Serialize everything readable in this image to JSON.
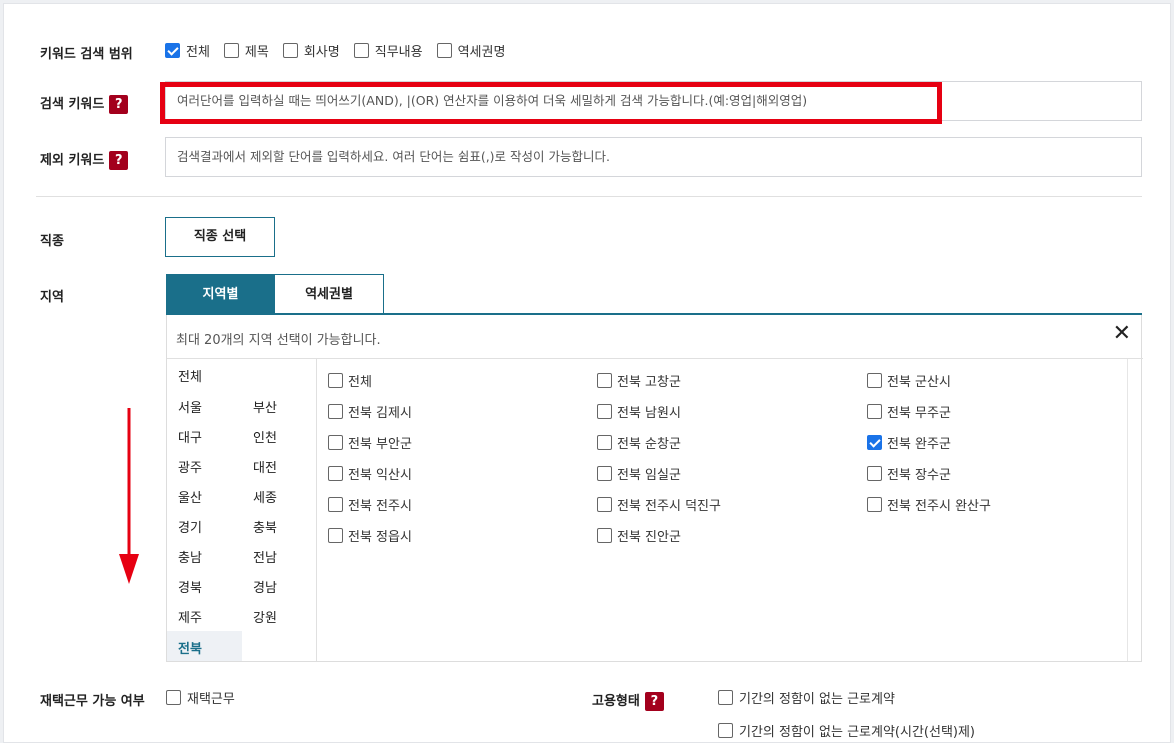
{
  "keyword_scope": {
    "label": "키워드 검색 범위",
    "options": [
      {
        "label": "전체",
        "checked": true
      },
      {
        "label": "제목",
        "checked": false
      },
      {
        "label": "회사명",
        "checked": false
      },
      {
        "label": "직무내용",
        "checked": false
      },
      {
        "label": "역세권명",
        "checked": false
      }
    ]
  },
  "search_keyword": {
    "label": "검색 키워드",
    "help": "?",
    "placeholder": "여러단어를 입력하실 때는 띄어쓰기(AND), |(OR) 연산자를 이용하여 더욱 세밀하게 검색 가능합니다.(예:영업|해외영업)"
  },
  "exclude_keyword": {
    "label": "제외 키워드",
    "help": "?",
    "placeholder": "검색결과에서 제외할 단어를 입력하세요. 여러 단어는 쉼표(,)로 작성이 가능합니다."
  },
  "job_type": {
    "label": "직종",
    "button": "직종 선택"
  },
  "region": {
    "label": "지역",
    "tabs": [
      "지역별",
      "역세권별"
    ],
    "info": "최대 20개의 지역 선택이 가능합니다.",
    "close": "✕",
    "provinces": [
      "전체",
      "서울",
      "부산",
      "대구",
      "인천",
      "광주",
      "대전",
      "울산",
      "세종",
      "경기",
      "충북",
      "충남",
      "전남",
      "경북",
      "경남",
      "제주",
      "강원",
      "전북"
    ],
    "selected_province": "전북",
    "cities": [
      {
        "label": "전체",
        "checked": false
      },
      {
        "label": "전북 고창군",
        "checked": false
      },
      {
        "label": "전북 군산시",
        "checked": false
      },
      {
        "label": "전북 김제시",
        "checked": false
      },
      {
        "label": "전북 남원시",
        "checked": false
      },
      {
        "label": "전북 무주군",
        "checked": false
      },
      {
        "label": "전북 부안군",
        "checked": false
      },
      {
        "label": "전북 순창군",
        "checked": false
      },
      {
        "label": "전북 완주군",
        "checked": true
      },
      {
        "label": "전북 익산시",
        "checked": false
      },
      {
        "label": "전북 임실군",
        "checked": false
      },
      {
        "label": "전북 장수군",
        "checked": false
      },
      {
        "label": "전북 전주시",
        "checked": false
      },
      {
        "label": "전북 전주시 덕진구",
        "checked": false
      },
      {
        "label": "전북 전주시 완산구",
        "checked": false
      },
      {
        "label": "전북 정읍시",
        "checked": false
      },
      {
        "label": "전북 진안군",
        "checked": false
      }
    ]
  },
  "remote_work": {
    "label": "재택근무 가능 여부",
    "option": {
      "label": "재택근무",
      "checked": false
    }
  },
  "employment_type": {
    "label": "고용형태",
    "help": "?",
    "options": [
      {
        "label": "기간의 정함이 없는 근로계약",
        "checked": false
      },
      {
        "label": "기간의 정함이 없는 근로계약(시간(선택)제)",
        "checked": false
      }
    ]
  },
  "colors": {
    "accent": "#1a6f8a",
    "highlight": "#e60012",
    "help_badge": "#a3001d",
    "checkbox": "#1a73e8"
  }
}
